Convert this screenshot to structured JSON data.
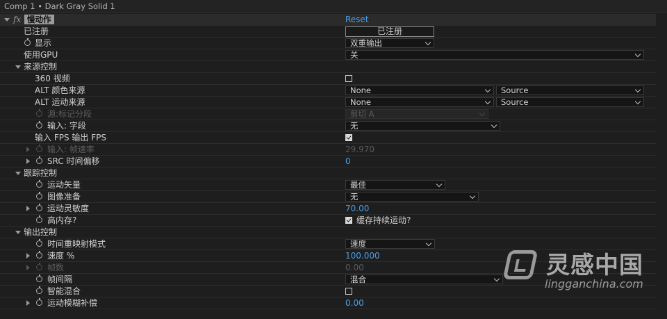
{
  "title": "Comp 1 • Dark Gray Solid 1",
  "effect": {
    "name": "慢动作",
    "reset": "Reset"
  },
  "rows": {
    "registered": {
      "label": "已注册",
      "button": "已注册"
    },
    "display": {
      "label": "显示",
      "value": "双重输出"
    },
    "gpu": {
      "label": "使用GPU",
      "value": "关"
    },
    "source_group": {
      "label": "来源控制"
    },
    "video360": {
      "label": "360 视频",
      "checked": false
    },
    "alt_color": {
      "label": "ALT 颜色来源",
      "value1": "None",
      "value2": "Source"
    },
    "alt_motion": {
      "label": "ALT 运动来源",
      "value1": "None",
      "value2": "Source"
    },
    "src_marker": {
      "label": "源:标记分段",
      "value": "剪切 A"
    },
    "input_field": {
      "label": "输入: 字段",
      "value": "无"
    },
    "fps_io": {
      "label": "输入 FPS 输出 FPS",
      "checked": true
    },
    "input_rate": {
      "label": "输入: 帧速率",
      "value": "29.970"
    },
    "src_offset": {
      "label": "SRC 时间偏移",
      "value": "0"
    },
    "track_group": {
      "label": "跟踪控制"
    },
    "motion_vector": {
      "label": "运动矢量",
      "value": "最佳"
    },
    "image_prep": {
      "label": "图像准备",
      "value": "无"
    },
    "motion_sens": {
      "label": "运动灵敏度",
      "value": "70.00"
    },
    "high_mem": {
      "label": "高内存?",
      "checked": true,
      "check_label": "缓存持续运动?"
    },
    "output_group": {
      "label": "输出控制"
    },
    "remap_mode": {
      "label": "时间重映射模式",
      "value": "速度"
    },
    "speed": {
      "label": "速度 %",
      "value": "100.000"
    },
    "frames": {
      "label": "帧数",
      "value": "0.00"
    },
    "frame_interval": {
      "label": "帧间隔",
      "value": "混合"
    },
    "smart_blend": {
      "label": "智能混合",
      "checked": false
    },
    "motion_blur": {
      "label": "运动模糊补偿",
      "value": "0.00"
    }
  },
  "watermark": {
    "cn": "灵感中国",
    "en": "lingganchina.com"
  },
  "colors": {
    "background": "#1e1e1e",
    "accent": "#4a9fe8"
  }
}
